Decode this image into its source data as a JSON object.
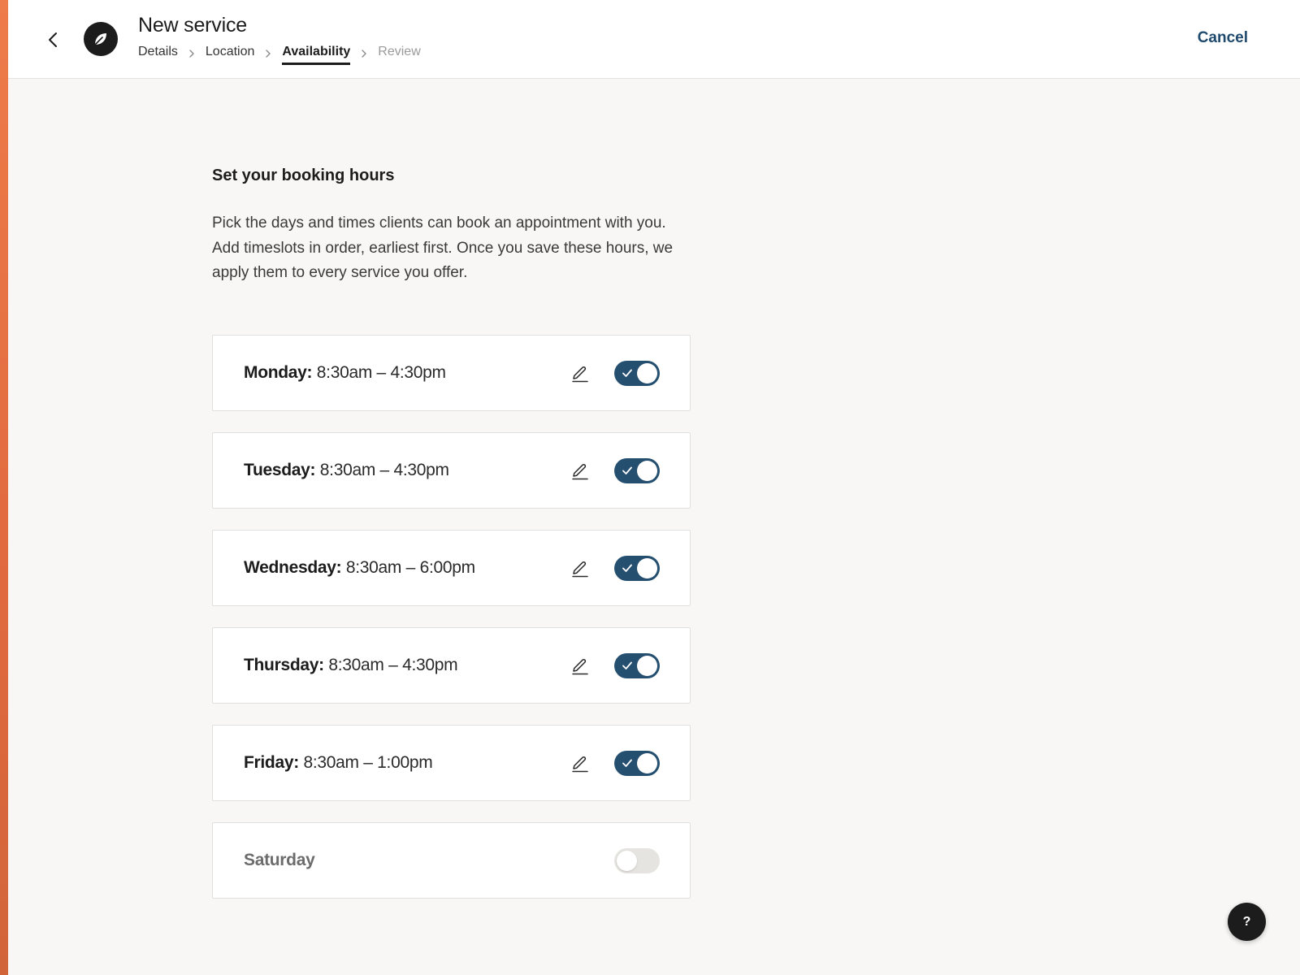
{
  "header": {
    "title": "New service",
    "cancel_label": "Cancel",
    "breadcrumb": [
      {
        "label": "Details",
        "state": "done"
      },
      {
        "label": "Location",
        "state": "done"
      },
      {
        "label": "Availability",
        "state": "active"
      },
      {
        "label": "Review",
        "state": "disabled"
      }
    ]
  },
  "main": {
    "section_title": "Set your booking hours",
    "intro": "Pick the days and times clients can book an appointment with you. Add timeslots in order, earliest first. Once you save these hours, we apply them to every service you offer.",
    "days": [
      {
        "name": "Monday:",
        "hours": "8:30am – 4:30pm",
        "enabled": true
      },
      {
        "name": "Tuesday:",
        "hours": "8:30am – 4:30pm",
        "enabled": true
      },
      {
        "name": "Wednesday:",
        "hours": "8:30am – 6:00pm",
        "enabled": true
      },
      {
        "name": "Thursday:",
        "hours": "8:30am – 4:30pm",
        "enabled": true
      },
      {
        "name": "Friday:",
        "hours": "8:30am – 1:00pm",
        "enabled": true
      },
      {
        "name": "Saturday",
        "hours": "",
        "enabled": false
      }
    ]
  },
  "help_label": "?",
  "icons": {
    "back": "chevron-left-icon",
    "logo": "leaf-logo-icon",
    "separator": "chevron-right-icon",
    "edit": "pencil-icon",
    "toggle_on": "check-icon"
  },
  "colors": {
    "accent_strip": "#ee7b4a",
    "toggle_on": "#254f6f",
    "toggle_off": "#e6e4e0",
    "cancel_link": "#1f4a6e"
  }
}
